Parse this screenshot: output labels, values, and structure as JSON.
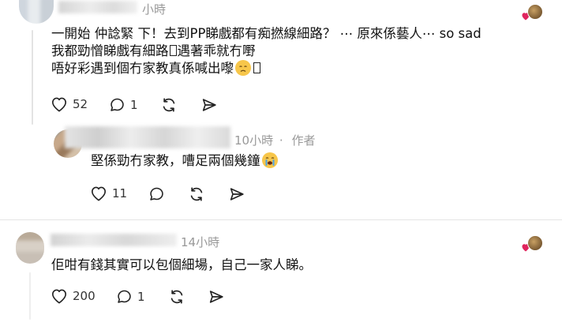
{
  "comments": [
    {
      "time": "小時",
      "lines": [
        "一開始 仲諗緊 下！去到PP睇戲都有痴撚線細路？ ⋯ 原來係藝人⋯ so sad",
        "我都勁憎睇戲有細路",
        "遇著乖就冇嘢",
        "唔好彩遇到個冇家教真係喊出嚟"
      ],
      "likes": "52",
      "replies": "1"
    },
    {
      "time": "10小時",
      "separator": "·",
      "author_tag": "作者",
      "lines": [
        "堅係勁冇家教，嘈足兩個幾鐘"
      ],
      "likes": "11"
    },
    {
      "time": "14小時",
      "lines": [
        "佢咁有錢其實可以包個細場，自己一家人睇。"
      ],
      "likes": "200",
      "replies": "1"
    }
  ],
  "icons": [
    "heart-icon",
    "comment-icon",
    "repost-icon",
    "share-icon",
    "loudly-crying-emoji",
    "disappointed-emoji"
  ],
  "colors": {
    "heart_red": "#e0245e",
    "meta_gray": "#999999",
    "divider": "#e5e5e5"
  }
}
